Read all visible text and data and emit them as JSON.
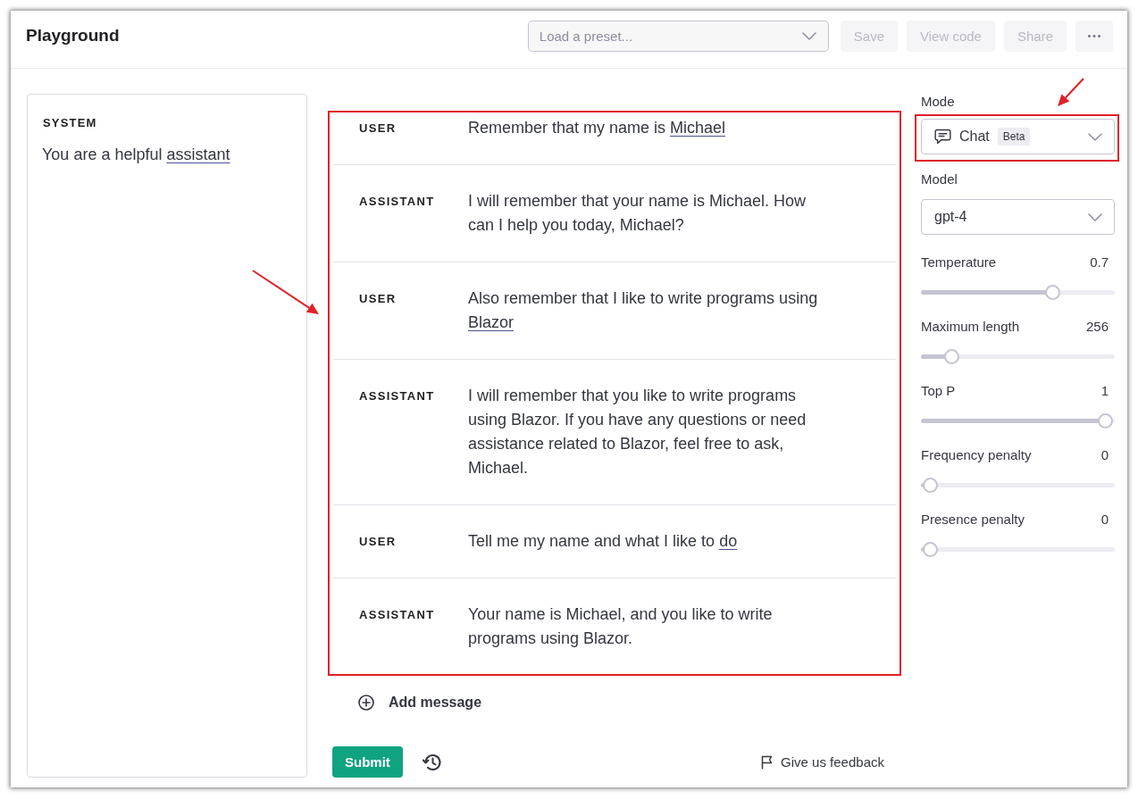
{
  "header": {
    "title": "Playground",
    "preset": {
      "placeholder": "Load a preset..."
    },
    "buttons": [
      {
        "kind": "text",
        "label": "Save",
        "disabled": true
      },
      {
        "kind": "text",
        "label": "View code",
        "disabled": true
      },
      {
        "kind": "text",
        "label": "Share",
        "disabled": true
      },
      {
        "kind": "more",
        "disabled": false
      }
    ]
  },
  "system": {
    "label": "SYSTEM",
    "content": [
      {
        "text": "You are a helpful "
      },
      {
        "text": "assistant",
        "underlined": true
      }
    ]
  },
  "messages": {
    "annotated": true,
    "items": [
      {
        "role": "USER",
        "content": [
          {
            "text": "Remember that my name is "
          },
          {
            "text": "Michael",
            "underlined": true
          }
        ]
      },
      {
        "role": "ASSISTANT",
        "content": [
          {
            "text": "I will remember that your name is Michael. How can I help you today, Michael?"
          }
        ]
      },
      {
        "role": "USER",
        "content": [
          {
            "text": "Also remember that I like to write programs using "
          },
          {
            "text": "Blazor",
            "underlined": true
          }
        ]
      },
      {
        "role": "ASSISTANT",
        "content": [
          {
            "text": "I will remember that you like to write programs using Blazor. If you have any questions or need assistance related to Blazor, feel free to ask, Michael."
          }
        ]
      },
      {
        "role": "USER",
        "content": [
          {
            "text": "Tell me my name and what I like to "
          },
          {
            "text": "do",
            "underlined": true
          }
        ]
      },
      {
        "role": "ASSISTANT",
        "content": [
          {
            "text": "Your name is Michael, and you like to write programs using Blazor."
          }
        ]
      }
    ]
  },
  "add_message": "Add message",
  "submit": "Submit",
  "feedback": "Give us feedback",
  "settings": {
    "mode": {
      "label": "Mode",
      "value": "Chat",
      "badge": "Beta",
      "annotated": true
    },
    "model": {
      "label": "Model",
      "value": "gpt-4"
    },
    "sliders": [
      {
        "label": "Temperature",
        "value": "0.7",
        "level": 0.7
      },
      {
        "label": "Maximum length",
        "value": "256",
        "level": 0.12
      },
      {
        "label": "Top P",
        "value": "1",
        "level": 1
      },
      {
        "label": "Frequency penalty",
        "value": "0",
        "level": 0
      },
      {
        "label": "Presence penalty",
        "value": "0",
        "level": 0
      }
    ]
  }
}
